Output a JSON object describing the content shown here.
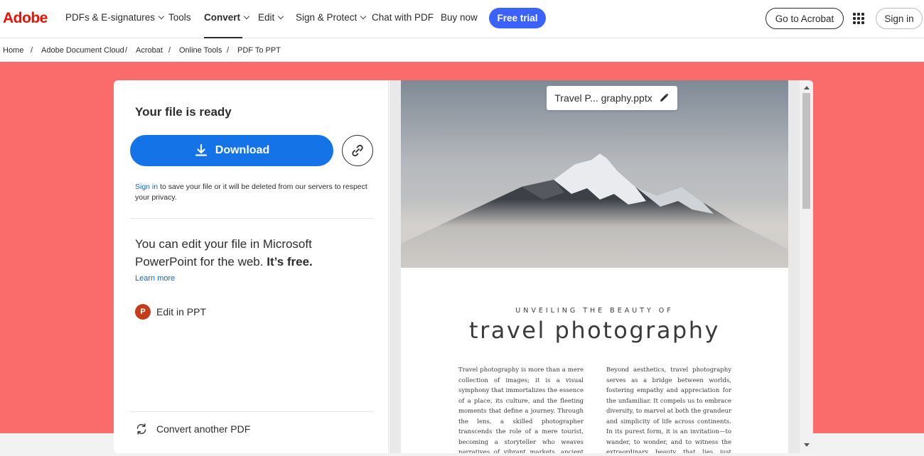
{
  "brand": {
    "logo": "Adobe",
    "accent": "#eb1000"
  },
  "nav": {
    "items": [
      {
        "label": "PDFs & E-signatures",
        "dropdown": true
      },
      {
        "label": "Tools",
        "dropdown": false
      },
      {
        "label": "Convert",
        "dropdown": true,
        "active": true
      },
      {
        "label": "Edit",
        "dropdown": true
      },
      {
        "label": "Sign & Protect",
        "dropdown": true
      },
      {
        "label": "Chat with PDF",
        "dropdown": false
      },
      {
        "label": "Buy now",
        "dropdown": false
      }
    ],
    "free_trial": "Free trial",
    "go_to_acrobat": "Go to Acrobat",
    "sign_in": "Sign in",
    "apps_icon": "app-grid-icon"
  },
  "breadcrumb": [
    "Home",
    "Adobe Document Cloud",
    "Acrobat",
    "Online Tools",
    "PDF To PPT"
  ],
  "result": {
    "title": "Your file is ready",
    "download_label": "Download",
    "share_link_icon": "link-icon",
    "sign_in_link": "Sign in",
    "sign_in_note": " to save your file or it will be deleted from our servers to respect your privacy.",
    "edit_msg_plain": "You can edit your file in Microsoft PowerPoint for the web. ",
    "edit_msg_bold": "It’s free.",
    "learn_more": "Learn more",
    "edit_in_ppt": "Edit in PPT",
    "ppt_icon_letter": "P",
    "convert_another": "Convert another PDF"
  },
  "preview": {
    "filename": "Travel P... graphy.pptx",
    "kicker": "UNVEILING THE BEAUTY OF",
    "title": "travel photography",
    "col_left": "Travel photography is more than a mere collection of images; it is a visual symphony that immortalizes the essence of a place, its culture, and the fleeting moments that define a journey. Through the lens, a skilled photographer transcends the role of a mere tourist, becoming a storyteller who weaves narratives of vibrant markets, ancient ruins, and landscapes bathed in ethereal light.",
    "col_right": "Beyond aesthetics, travel photography serves as a bridge between worlds, fostering empathy and appreciation for the unfamiliar. It compels us to embrace diversity, to marvel at both the grandeur and simplicity of life across continents. In its purest form, it is an invitation—to wander, to wonder, and to witness the extraordinary beauty that lies just beyond the horizon, waiting to be captured in"
  },
  "colors": {
    "band": "#fa6b6b",
    "primary_button": "#1473e6",
    "free_trial": "#3b63fb"
  }
}
